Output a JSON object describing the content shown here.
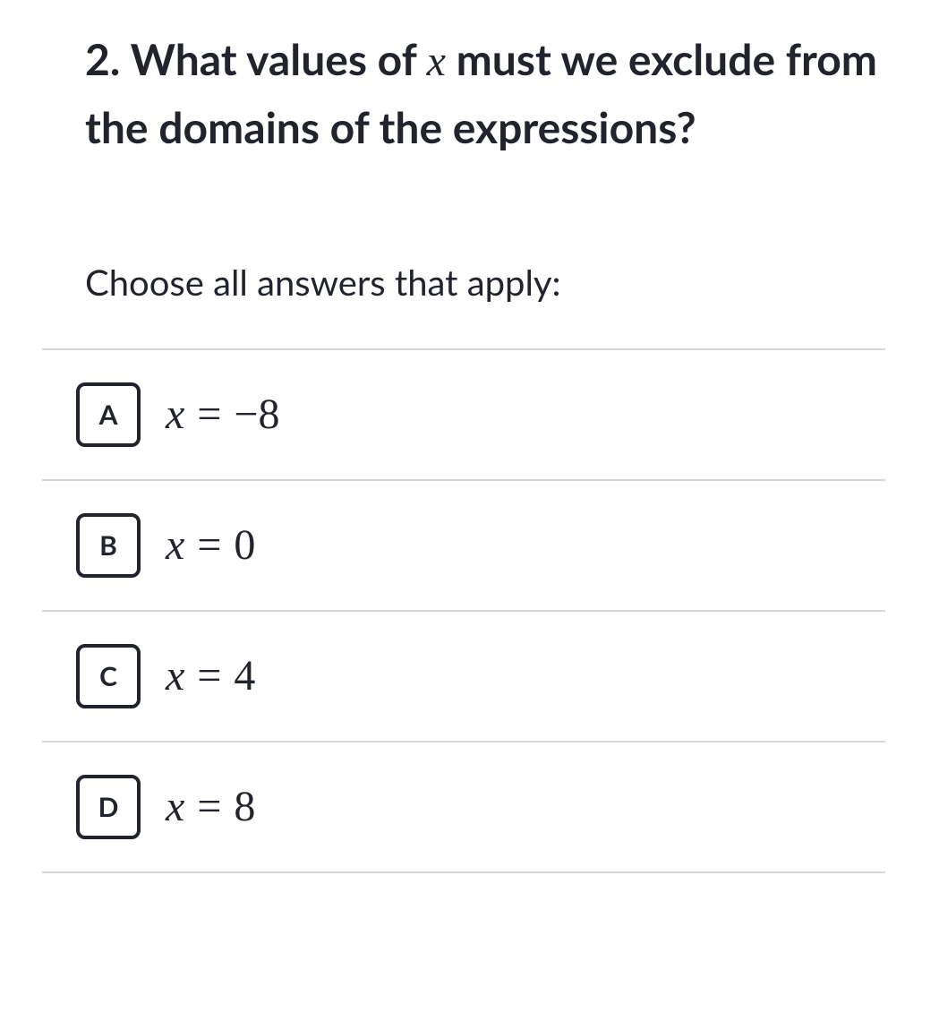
{
  "question": {
    "number": "2.",
    "text_part1": "What values of ",
    "text_var": "x",
    "text_part2": " must we exclude from the domains of the expressions?"
  },
  "instruction": "Choose all answers that apply:",
  "options": [
    {
      "letter": "A",
      "var": "x",
      "eq": "=",
      "value": "−8"
    },
    {
      "letter": "B",
      "var": "x",
      "eq": "=",
      "value": "0"
    },
    {
      "letter": "C",
      "var": "x",
      "eq": "=",
      "value": "4"
    },
    {
      "letter": "D",
      "var": "x",
      "eq": "=",
      "value": "8"
    }
  ]
}
